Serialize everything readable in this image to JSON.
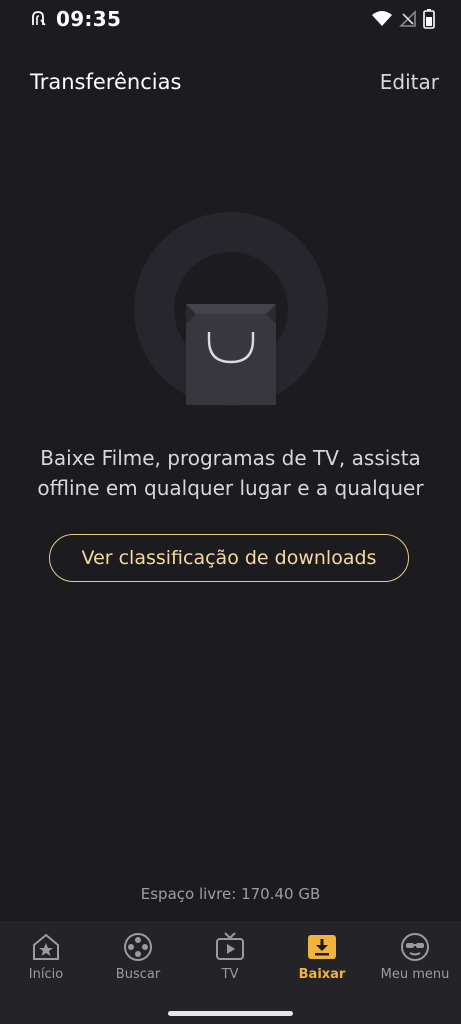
{
  "status_bar": {
    "time": "09:35",
    "icons": [
      "notification-icon",
      "wifi-icon",
      "signal-icon",
      "battery-icon"
    ]
  },
  "header": {
    "title": "Transferências",
    "edit_label": "Editar"
  },
  "empty_state": {
    "illustration": "shopping-bag-icon",
    "message": "Baixe Filme, programas de TV, assista offline em qualquer lugar e a qualquer",
    "button_label": "Ver classificação de downloads"
  },
  "storage": {
    "free_space": "Espaço livre: 170.40 GB"
  },
  "bottom_nav": {
    "items": [
      {
        "label": "Início",
        "icon": "home-icon",
        "active": false
      },
      {
        "label": "Buscar",
        "icon": "film-reel-icon",
        "active": false
      },
      {
        "label": "TV",
        "icon": "tv-icon",
        "active": false
      },
      {
        "label": "Baixar",
        "icon": "download-icon",
        "active": true
      },
      {
        "label": "Meu menu",
        "icon": "profile-icon",
        "active": false
      }
    ]
  },
  "colors": {
    "background": "#1b1b20",
    "accent": "#f0b43c",
    "button_border": "#e8c98a"
  }
}
